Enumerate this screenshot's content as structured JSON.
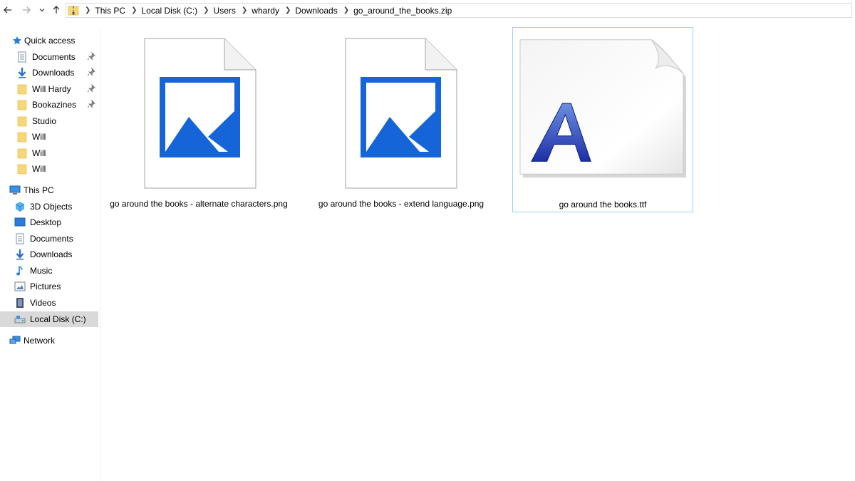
{
  "nav": {
    "back_icon": "arrow-left-icon",
    "forward_icon": "arrow-right-icon",
    "recent_icon": "chevron-down-icon",
    "up_icon": "arrow-up-icon"
  },
  "address_bar": {
    "icon": "zip-folder-icon",
    "crumbs": [
      "This PC",
      "Local Disk (C:)",
      "Users",
      "whardy",
      "Downloads",
      "go_around_the_books.zip"
    ]
  },
  "sidebar": {
    "quick_access": {
      "label": "Quick access",
      "icon": "star-icon"
    },
    "quick_items": [
      {
        "label": "Documents",
        "icon": "documents-icon",
        "pinned": true
      },
      {
        "label": "Downloads",
        "icon": "download-arrow-icon",
        "pinned": true
      },
      {
        "label": "Will Hardy",
        "icon": "folder-icon",
        "pinned": true
      },
      {
        "label": "Bookazines",
        "icon": "folder-icon",
        "pinned": true
      },
      {
        "label": "Studio",
        "icon": "folder-icon",
        "pinned": false
      },
      {
        "label": "Will",
        "icon": "folder-icon",
        "pinned": false
      },
      {
        "label": "Will",
        "icon": "folder-icon",
        "pinned": false
      },
      {
        "label": "Will",
        "icon": "folder-icon",
        "pinned": false
      }
    ],
    "this_pc": {
      "label": "This PC",
      "icon": "monitor-icon"
    },
    "pc_items": [
      {
        "label": "3D Objects",
        "icon": "cube-icon"
      },
      {
        "label": "Desktop",
        "icon": "desktop-icon"
      },
      {
        "label": "Documents",
        "icon": "documents-icon"
      },
      {
        "label": "Downloads",
        "icon": "download-arrow-icon"
      },
      {
        "label": "Music",
        "icon": "music-note-icon"
      },
      {
        "label": "Pictures",
        "icon": "pictures-icon"
      },
      {
        "label": "Videos",
        "icon": "film-icon"
      },
      {
        "label": "Local Disk (C:)",
        "icon": "drive-icon",
        "selected": true
      }
    ],
    "network": {
      "label": "Network",
      "icon": "network-icon"
    }
  },
  "files": [
    {
      "name": "go around the books - alternate characters.png",
      "icon": "image-file-icon",
      "selected": false
    },
    {
      "name": "go around the books - extend language.png",
      "icon": "image-file-icon",
      "selected": false
    },
    {
      "name": "go around the books.ttf",
      "icon": "font-file-icon",
      "selected": true
    }
  ],
  "colors": {
    "image_blue": "#1565d8",
    "folder_yellow": "#f8d775",
    "selection_border": "#99d1ff",
    "selected_nav": "#d9d9d9",
    "font_glyph_blue": "#1c2fa8"
  }
}
